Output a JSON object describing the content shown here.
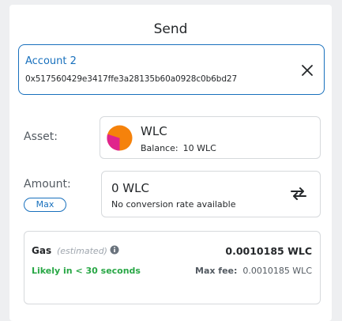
{
  "header": {
    "title": "Send"
  },
  "recipient": {
    "account_name": "Account 2",
    "address": "0x517560429e3417ffe3a28135b60a0928c0b6bd27",
    "close_icon": "close-icon"
  },
  "asset": {
    "label": "Asset:",
    "token_symbol": "WLC",
    "balance_label": "Balance:",
    "balance_value": "10 WLC",
    "icon": "token-icon",
    "icon_colors": [
      "#f5820b",
      "#e0248c"
    ]
  },
  "amount": {
    "label": "Amount:",
    "max_label": "Max",
    "value": "0 WLC",
    "conversion_text": "No conversion rate available",
    "swap_icon": "swap-icon"
  },
  "gas": {
    "label": "Gas",
    "estimated_label": "(estimated)",
    "info_icon": "info-icon",
    "total": "0.0010185 WLC",
    "likely_text": "Likely in < 30 seconds",
    "max_fee_label": "Max fee:",
    "max_fee_value": "0.0010185 WLC"
  },
  "colors": {
    "accent": "#1870bd",
    "success": "#28a745",
    "border": "#d6d9dc",
    "background": "#eeeff1"
  }
}
